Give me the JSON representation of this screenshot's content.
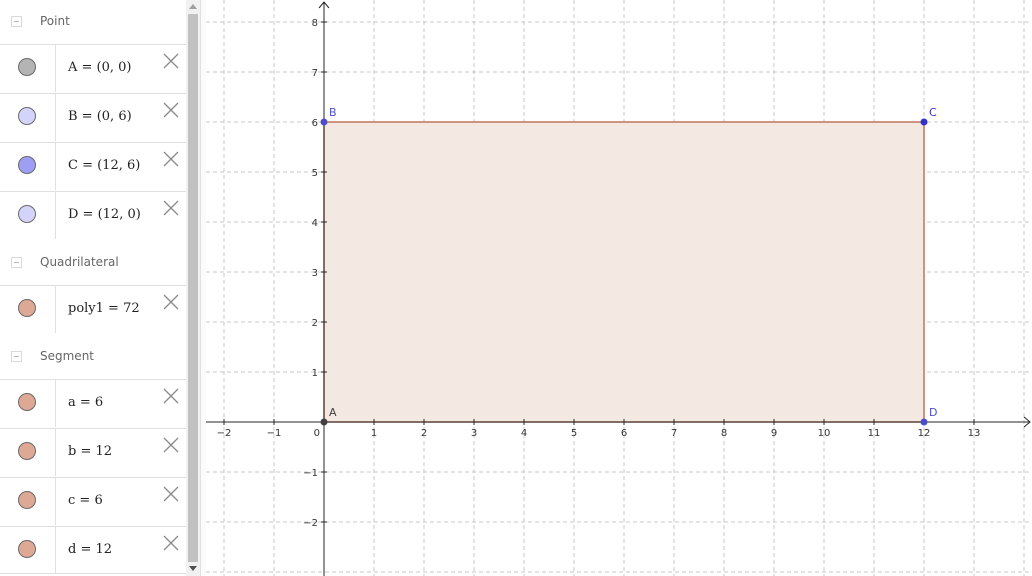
{
  "algebra": {
    "groups": [
      {
        "title": "Point",
        "items": [
          {
            "text": "A = (0, 0)",
            "color": "#b4b4b4"
          },
          {
            "text": "B = (0, 6)",
            "color": "#d4d4fa"
          },
          {
            "text": "C = (12, 6)",
            "color": "#9e9ef5"
          },
          {
            "text": "D = (12, 0)",
            "color": "#d4d4fa"
          }
        ]
      },
      {
        "title": "Quadrilateral",
        "items": [
          {
            "text": "poly1 = 72",
            "color": "#dda894"
          }
        ]
      },
      {
        "title": "Segment",
        "items": [
          {
            "text": "a = 6",
            "color": "#dda894"
          },
          {
            "text": "b = 12",
            "color": "#dda894"
          },
          {
            "text": "c = 6",
            "color": "#dda894"
          },
          {
            "text": "d = 12",
            "color": "#dda894"
          }
        ]
      }
    ]
  },
  "graphics": {
    "x_ticks": [
      "−2",
      "−1",
      "0",
      "1",
      "2",
      "3",
      "4",
      "5",
      "6",
      "7",
      "8",
      "9",
      "10",
      "11",
      "12",
      "13"
    ],
    "y_ticks": [
      "−2",
      "−1",
      "1",
      "2",
      "3",
      "4",
      "5",
      "6",
      "7",
      "8"
    ],
    "points": [
      {
        "label": "A",
        "x": 0,
        "y": 0,
        "color": "#404040"
      },
      {
        "label": "B",
        "x": 0,
        "y": 6,
        "color": "#4d4dcc"
      },
      {
        "label": "C",
        "x": 12,
        "y": 6,
        "color": "#3333cc"
      },
      {
        "label": "D",
        "x": 12,
        "y": 0,
        "color": "#4d4dcc"
      }
    ],
    "polygon": {
      "name": "poly1",
      "fill": "#f4e8e2",
      "stroke": "#c0765a"
    },
    "grid": true,
    "grid_color": "#c8c8c8",
    "axis_color": "#252525"
  }
}
